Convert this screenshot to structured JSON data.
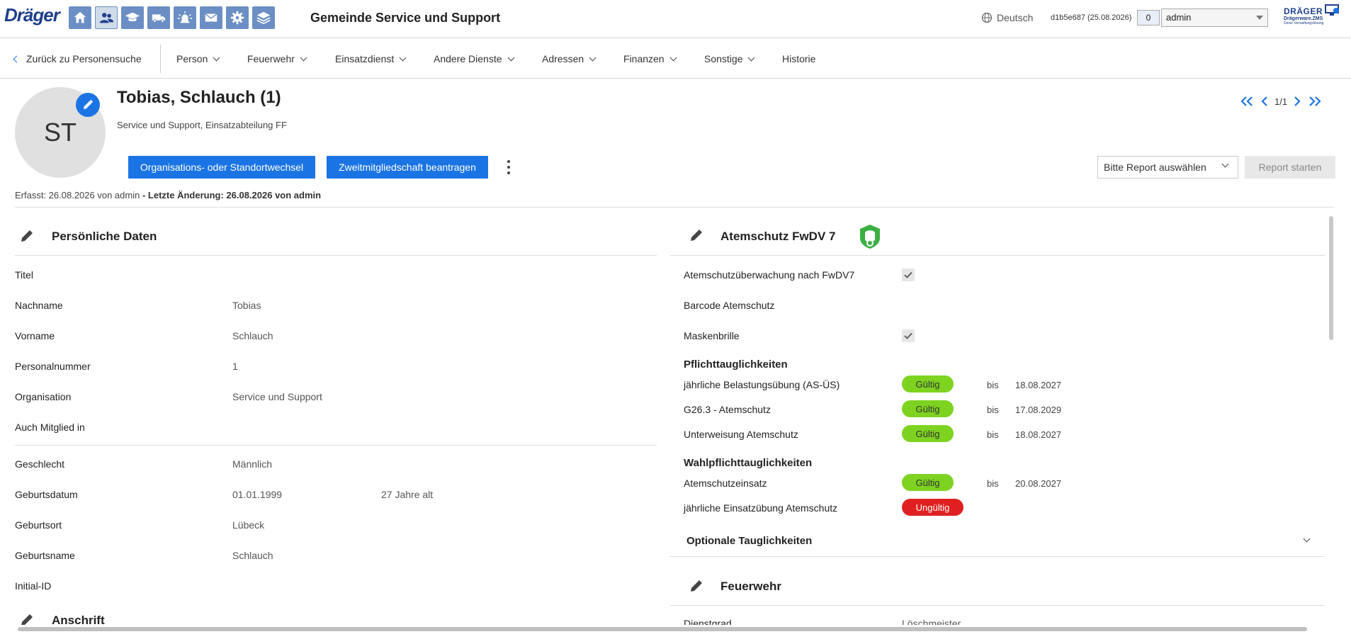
{
  "app": {
    "brand": "Dräger",
    "title": "Gemeinde Service und Support",
    "language": "Deutsch",
    "version": "d1b5e687 (25.08.2026)",
    "message_count": "0",
    "user": "admin",
    "brand_right": {
      "line1": "DRÄGER",
      "line2": "Drägerware.ZMS",
      "line3": "Deine Verwaltungslösung"
    },
    "nav_icons": [
      "home-icon",
      "persons-icon",
      "education-icon",
      "vehicle-icon",
      "alarm-icon",
      "mail-icon",
      "settings-icon",
      "layers-icon"
    ],
    "accent": "#1b74e4"
  },
  "menu": {
    "back": "Zurück zu Personensuche",
    "items": [
      "Person",
      "Feuerwehr",
      "Einsatzdienst",
      "Andere Dienste",
      "Adressen",
      "Finanzen",
      "Sonstige",
      "Historie"
    ]
  },
  "person": {
    "initials": "ST",
    "name": "Tobias, Schlauch (1)",
    "subtitle": "Service und Support, Einsatzabteilung FF",
    "btn_change": "Organisations- oder Standortwechsel",
    "btn_second": "Zweitmitgliedschaft beantragen",
    "pager": "1/1",
    "report_placeholder": "Bitte Report auswählen",
    "report_start": "Report starten",
    "meta_created": "Erfasst: 26.08.2026 von admin",
    "meta_changed": " - Letzte Änderung: 26.08.2026 von admin"
  },
  "personal": {
    "title": "Persönliche Daten",
    "rows1": [
      {
        "label": "Titel",
        "value": ""
      },
      {
        "label": "Nachname",
        "value": "Tobias"
      },
      {
        "label": "Vorname",
        "value": "Schlauch"
      },
      {
        "label": "Personalnummer",
        "value": "1"
      },
      {
        "label": "Organisation",
        "value": "Service und Support"
      },
      {
        "label": "Auch Mitglied in",
        "value": ""
      }
    ],
    "rows2": [
      {
        "label": "Geschlecht",
        "value": "Männlich"
      },
      {
        "label": "Geburtsdatum",
        "value": "01.01.1999",
        "extra": "27 Jahre alt"
      },
      {
        "label": "Geburtsort",
        "value": "Lübeck"
      },
      {
        "label": "Geburtsname",
        "value": "Schlauch"
      },
      {
        "label": "Initial-ID",
        "value": ""
      }
    ],
    "next_section": "Anschrift"
  },
  "atemschutz": {
    "title": "Atemschutz FwDV 7",
    "rows": [
      {
        "label": "Atemschutzüberwachung nach FwDV7",
        "checked": true
      },
      {
        "label": "Barcode Atemschutz",
        "checked": false
      },
      {
        "label": "Maskenbrille",
        "checked": true
      }
    ],
    "pflicht_title": "Pflichttauglichkeiten",
    "pflicht": [
      {
        "label": "jährliche Belastungsübung (AS-ÜS)",
        "status": "Gültig",
        "bis": "bis",
        "date": "18.08.2027"
      },
      {
        "label": "G26.3 - Atemschutz",
        "status": "Gültig",
        "bis": "bis",
        "date": "17.08.2029"
      },
      {
        "label": "Unterweisung Atemschutz",
        "status": "Gültig",
        "bis": "bis",
        "date": "18.08.2027"
      }
    ],
    "wahl_title": "Wahlpflichttauglichkeiten",
    "wahl": [
      {
        "label": "Atemschutzeinsatz",
        "status": "Gültig",
        "bis": "bis",
        "date": "20.08.2027"
      },
      {
        "label": "jährliche Einsatzübung Atemschutz",
        "status": "Ungültig"
      }
    ],
    "optional_title": "Optionale Tauglichkeiten"
  },
  "feuerwehr": {
    "title": "Feuerwehr",
    "row_label": "Dienstgrad",
    "row_value": "Löschmeister"
  }
}
